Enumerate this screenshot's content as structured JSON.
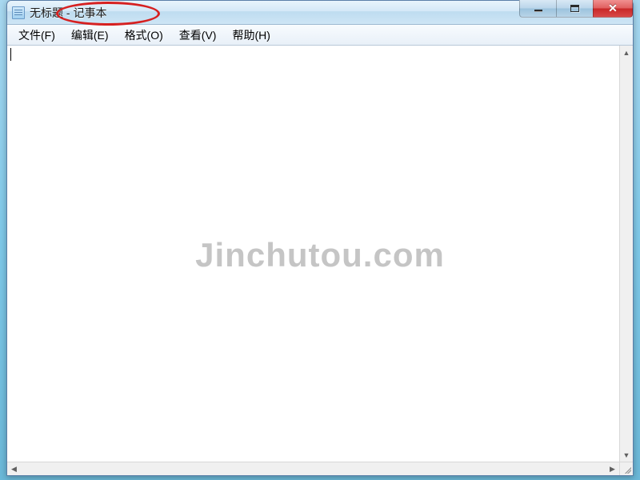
{
  "window": {
    "title": "无标题 - 记事本"
  },
  "menu": {
    "file": "文件(F)",
    "edit": "编辑(E)",
    "format": "格式(O)",
    "view": "查看(V)",
    "help": "帮助(H)"
  },
  "editor": {
    "content": ""
  },
  "watermark": "Jinchutou.com"
}
